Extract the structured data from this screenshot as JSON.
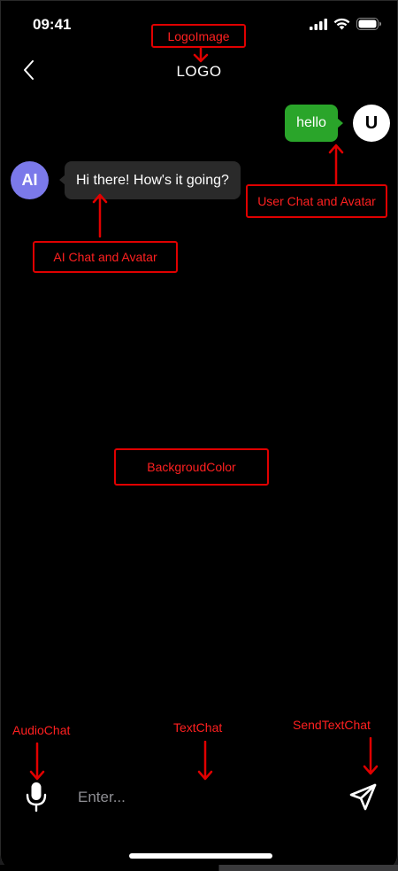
{
  "status_bar": {
    "time": "09:41",
    "icons": [
      "cellular-signal-icon",
      "wifi-icon",
      "battery-icon"
    ]
  },
  "nav": {
    "back_icon": "chevron-left-icon",
    "logo_text": "LOGO"
  },
  "messages": {
    "user": {
      "avatar": "U",
      "text": "hello"
    },
    "ai": {
      "avatar": "AI",
      "text": "Hi there! How's it going?"
    }
  },
  "annotations": {
    "logo_image": "LogoImage",
    "user_chat": "User Chat and Avatar",
    "ai_chat": "AI Chat and Avatar",
    "background_color": "BackgroudColor",
    "audio_chat": "AudioChat",
    "text_chat": "TextChat",
    "send_text_chat": "SendTextChat"
  },
  "composer": {
    "mic_icon": "microphone-icon",
    "placeholder": "Enter...",
    "send_icon": "send-icon"
  },
  "colors": {
    "background": "#000000",
    "user_bubble": "#2aa52a",
    "ai_avatar": "#7b79ea",
    "ai_bubble": "#2a2a2a",
    "annotation": "#e00000"
  }
}
